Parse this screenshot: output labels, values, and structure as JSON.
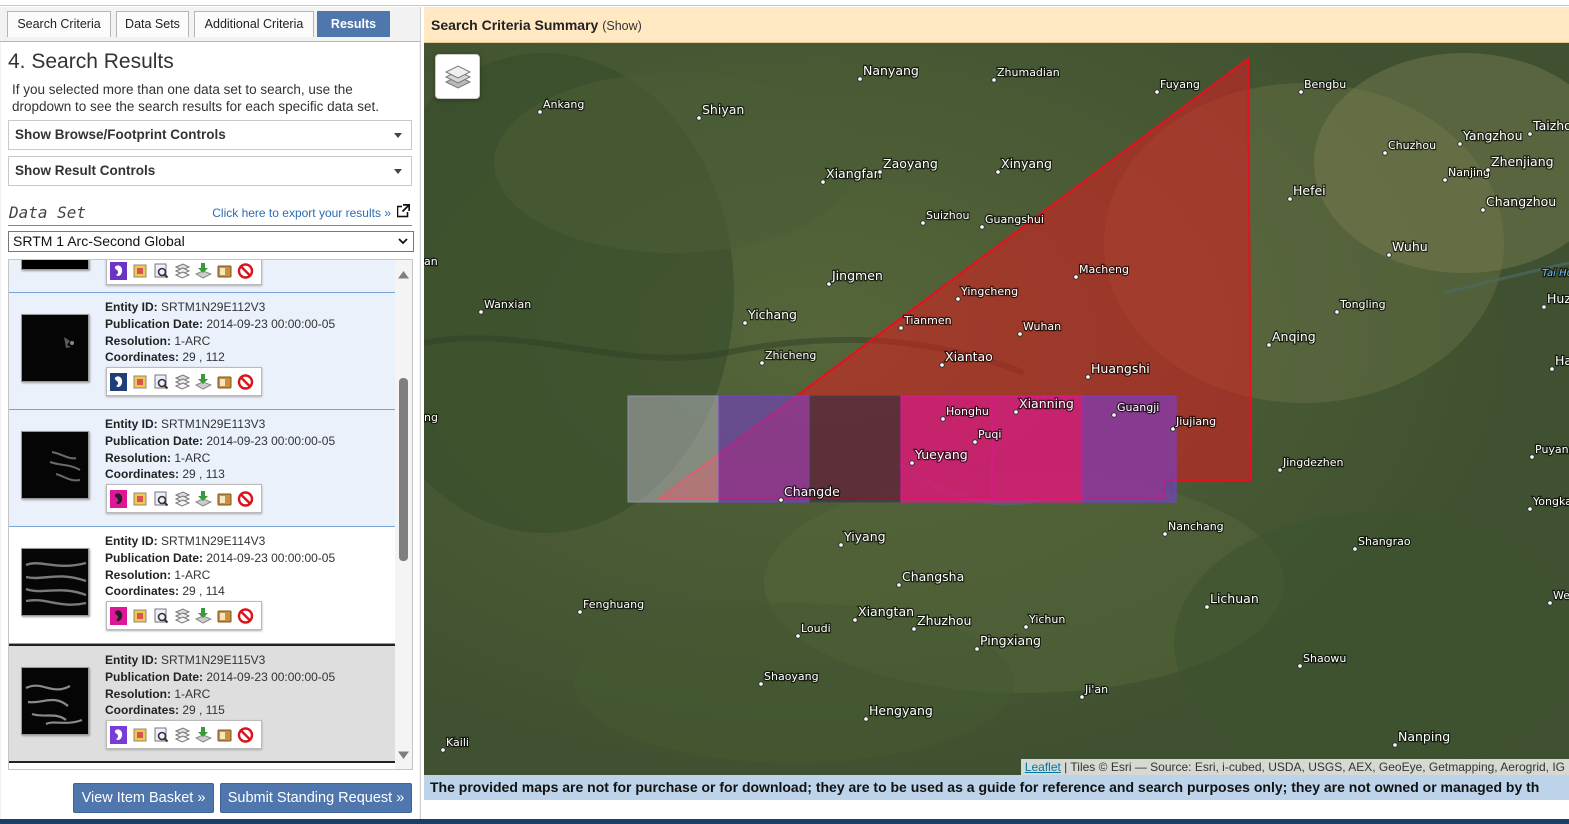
{
  "tabs": [
    {
      "label": "Search Criteria"
    },
    {
      "label": "Data Sets"
    },
    {
      "label": "Additional Criteria"
    },
    {
      "label": "Results"
    }
  ],
  "results_panel": {
    "heading": "4. Search Results",
    "intro": "If you selected more than one data set to search, use the dropdown to see the search results for each specific data set.",
    "browse_controls": "Show Browse/Footprint Controls",
    "result_controls": "Show Result Controls",
    "dataset_label": "Data Set",
    "export_link": "Click here to export your results »",
    "dataset_selected": "SRTM 1 Arc-Second Global"
  },
  "result_labels": {
    "entity": "Entity ID:",
    "pub": "Publication Date:",
    "res": "Resolution:",
    "coords": "Coordinates:"
  },
  "results": [
    {
      "entity_id": "SRTM1N29E112V3",
      "pub_date": "2014-09-23 00:00:00-05",
      "resolution": "1-ARC",
      "coordinates": "29 , 112",
      "footprint_color": "#1e3f7a"
    },
    {
      "entity_id": "SRTM1N29E113V3",
      "pub_date": "2014-09-23 00:00:00-05",
      "resolution": "1-ARC",
      "coordinates": "29 , 113",
      "footprint_color": "#e0169a"
    },
    {
      "entity_id": "SRTM1N29E114V3",
      "pub_date": "2014-09-23 00:00:00-05",
      "resolution": "1-ARC",
      "coordinates": "29 , 114",
      "footprint_color": "#e0169a"
    },
    {
      "entity_id": "SRTM1N29E115V3",
      "pub_date": "2014-09-23 00:00:00-05",
      "resolution": "1-ARC",
      "coordinates": "29 , 115",
      "footprint_color": "#7a3cd6"
    }
  ],
  "row_icons": [
    "footprint-icon",
    "overlay-icon",
    "metadata-icon",
    "compare-icon",
    "download-icon",
    "order-icon",
    "exclude-icon"
  ],
  "buttons": {
    "basket": "View Item Basket »",
    "standing": "Submit Standing Request »"
  },
  "map": {
    "summary_title": "Search Criteria Summary",
    "summary_toggle": "(Show)",
    "attribution_link": "Leaflet",
    "attribution_text": " | Tiles © Esri — Source: Esri, i-cubed, USDA, USGS, AEX, GeoEye, Getmapping, Aerogrid, IG",
    "disclaimer": "The provided maps are not for purchase or for download; they are to be used as a guide for reference and search purposes only; they are not owned or managed by th",
    "cities": [
      "Nanyang",
      "Zhumadian",
      "Fuyang",
      "Bengbu",
      "Ankang",
      "Shiyan",
      "Yangzhou",
      "Taizho",
      "Chuzhou",
      "Nanjing",
      "Zhenjiang",
      "Xiangfan",
      "Zaoyang",
      "Xinyang",
      "Hefei",
      "Changzhou",
      "Suizhou",
      "Guangshui",
      "Wuhu",
      "Tai Hu",
      "Jingmen",
      "Macheng",
      "Huz",
      "Wanxian",
      "Yingcheng",
      "Tongling",
      "Yichang",
      "Tianmen",
      "Wuhan",
      "Anqing",
      "Zhicheng",
      "Xiantao",
      "Huangshi",
      "Ha",
      "Honghu",
      "Xianning",
      "Guangji",
      "Jiujiang",
      "Puqi",
      "Puyang",
      "Yueyang",
      "Jingdezhen",
      "Changde",
      "Yongka",
      "Nanchang",
      "Yiyang",
      "Shangrao",
      "Changsha",
      "We",
      "Fenghuang",
      "Lichuan",
      "Xiangtan",
      "Zhuzhou",
      "Loudi",
      "Yichun",
      "Pingxiang",
      "Shaoyang",
      "Shaowu",
      "Ji'an",
      "Hengyang",
      "Nanping",
      "Kaili",
      "an",
      "ng"
    ]
  }
}
